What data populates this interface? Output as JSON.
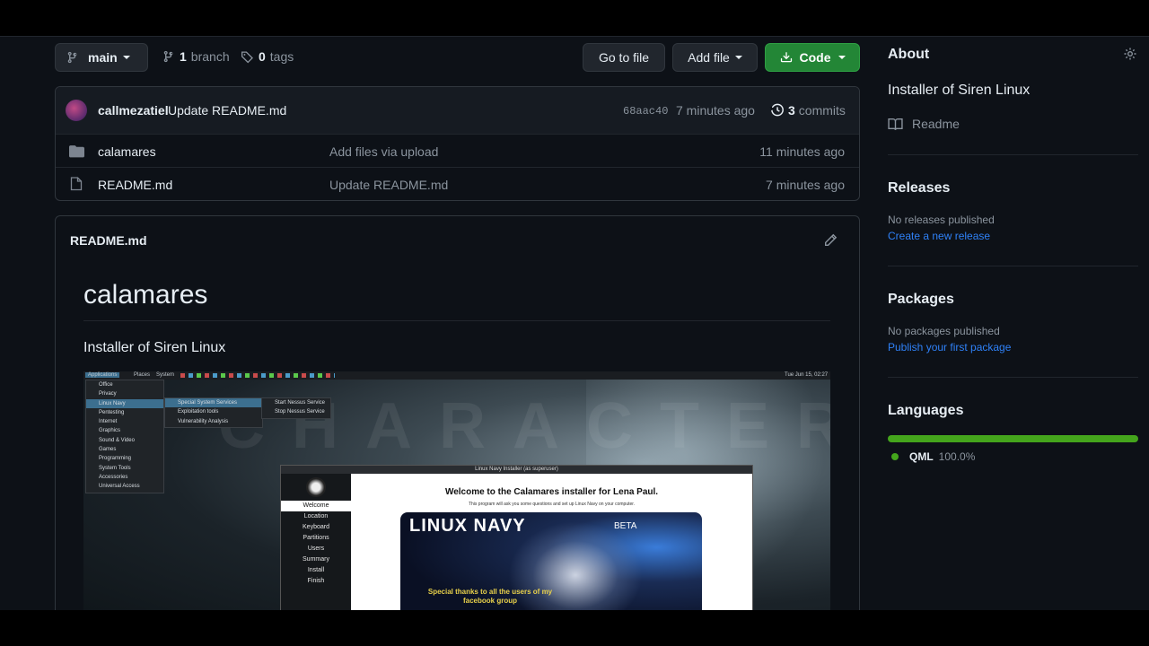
{
  "repo_nav": {
    "branch_button": "main",
    "branches_count": "1",
    "branches_label": "branch",
    "tags_count": "0",
    "tags_label": "tags",
    "go_to_file": "Go to file",
    "add_file": "Add file",
    "code": "Code"
  },
  "latest_commit": {
    "author": "callmezatiel",
    "message": "Update README.md",
    "sha": "68aac40",
    "time": "7 minutes ago",
    "commits_count": "3",
    "commits_label": "commits"
  },
  "files": [
    {
      "name": "calamares",
      "type": "folder",
      "message": "Add files via upload",
      "time": "11 minutes ago"
    },
    {
      "name": "README.md",
      "type": "file",
      "message": "Update README.md",
      "time": "7 minutes ago"
    }
  ],
  "readme": {
    "filename": "README.md",
    "heading": "calamares",
    "description": "Installer of Siren Linux",
    "screenshot": {
      "taskbar": [
        "Applications",
        "Places",
        "System"
      ],
      "clock": "Tue Jun 15, 02:27",
      "watermark": "CHARACTER",
      "app_menu": [
        "Office",
        "Privacy",
        "Linux Navy",
        "Pentesting",
        "Internet",
        "Graphics",
        "Sound & Video",
        "Games",
        "Programming",
        "System Tools",
        "Accessories",
        "Universal Access"
      ],
      "submenu": [
        "Special System Services",
        "Exploitation tools",
        "Vulnerability Analysis"
      ],
      "submenu2": [
        "Start Nessus Service",
        "Stop Nessus Service"
      ],
      "installer_title": "Linux Navy Installer (as superuser)",
      "installer_steps": [
        "Welcome",
        "Location",
        "Keyboard",
        "Partitions",
        "Users",
        "Summary",
        "Install",
        "Finish"
      ],
      "welcome_title": "Welcome to the Calamares installer for Lena Paul.",
      "welcome_sub": "This program will ask you some questions and set up Linux Navy on your computer.",
      "banner_title": "LINUX NAVY",
      "banner_beta": "BETA",
      "banner_thanks_1": "Special thanks to all the users of my",
      "banner_thanks_2": "facebook group"
    }
  },
  "sidebar": {
    "about_heading": "About",
    "description": "Installer of Siren Linux",
    "readme_link": "Readme",
    "releases_heading": "Releases",
    "releases_text": "No releases published",
    "releases_link": "Create a new release",
    "packages_heading": "Packages",
    "packages_text": "No packages published",
    "packages_link": "Publish your first package",
    "languages_heading": "Languages",
    "languages": [
      {
        "name": "QML",
        "percent": "100.0%",
        "fraction": 1.0,
        "color": "#44a51c"
      }
    ]
  },
  "colors": {
    "accent_green": "#238636",
    "link_blue": "#2f81f7",
    "bg": "#0d1117"
  }
}
